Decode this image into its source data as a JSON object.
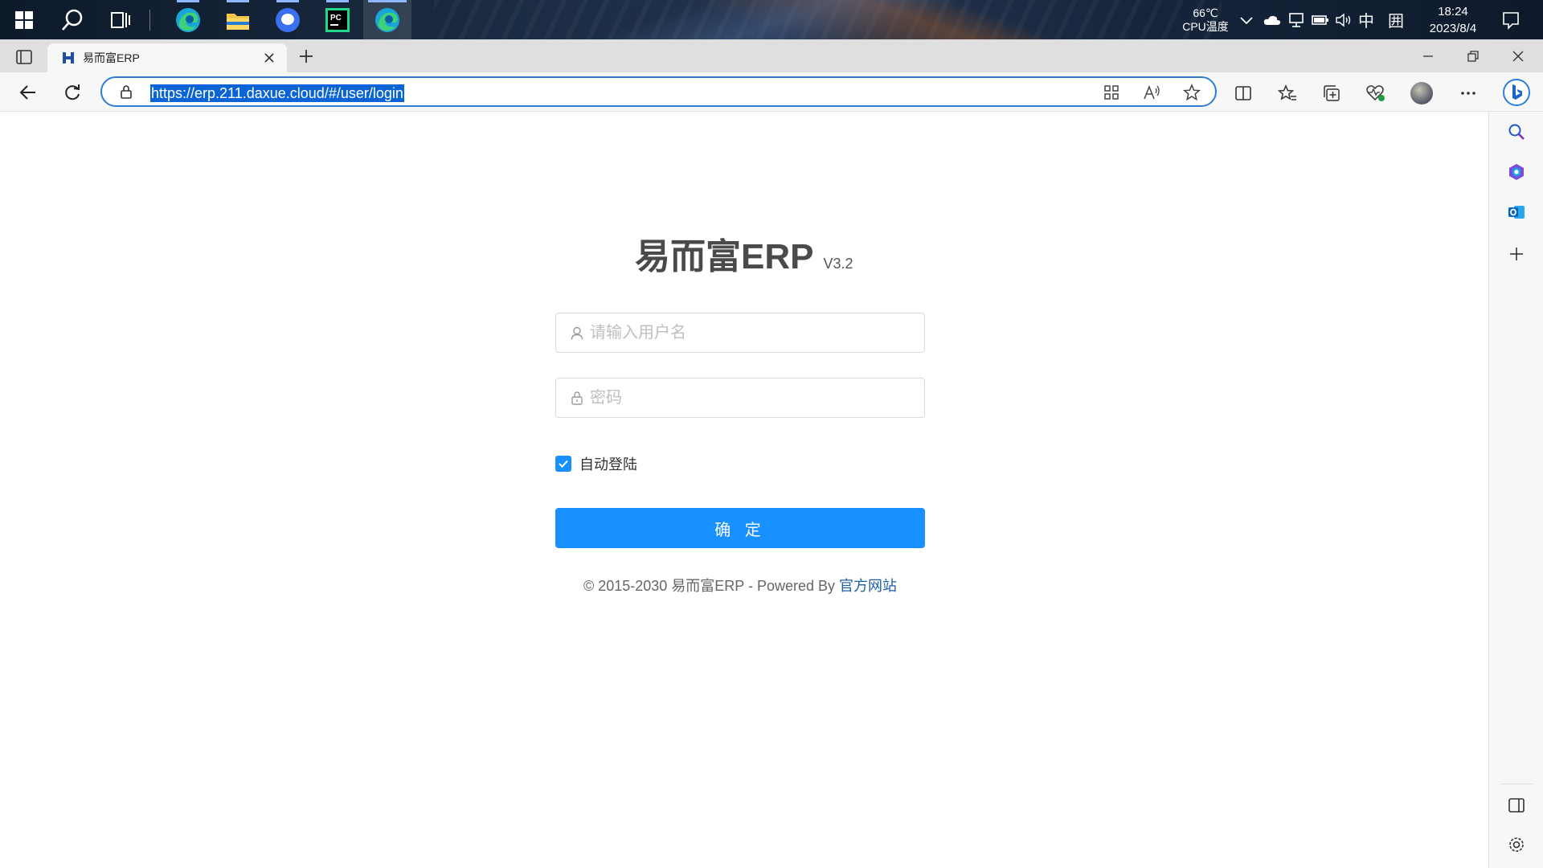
{
  "taskbar": {
    "temperature": "66℃",
    "temperature_label": "CPU温度",
    "ime_mode": "中",
    "ime_layout": "囲",
    "time": "18:24",
    "date": "2023/8/4"
  },
  "browser": {
    "tab": {
      "title": "易而富ERP"
    },
    "url": "https://erp.211.daxue.cloud/#/user/login"
  },
  "login": {
    "title": "易而富ERP",
    "version": "V3.2",
    "username_placeholder": "请输入用户名",
    "password_placeholder": "密码",
    "remember_label": "自动登陆",
    "remember_checked": true,
    "submit_label": "确 定"
  },
  "footer": {
    "copyright": "© 2015-2030 易而富ERP - Powered By ",
    "link_text": "官方网站"
  },
  "colors": {
    "primary": "#1890ff",
    "link": "#1f5fa8",
    "title": "#4a4a4a"
  }
}
